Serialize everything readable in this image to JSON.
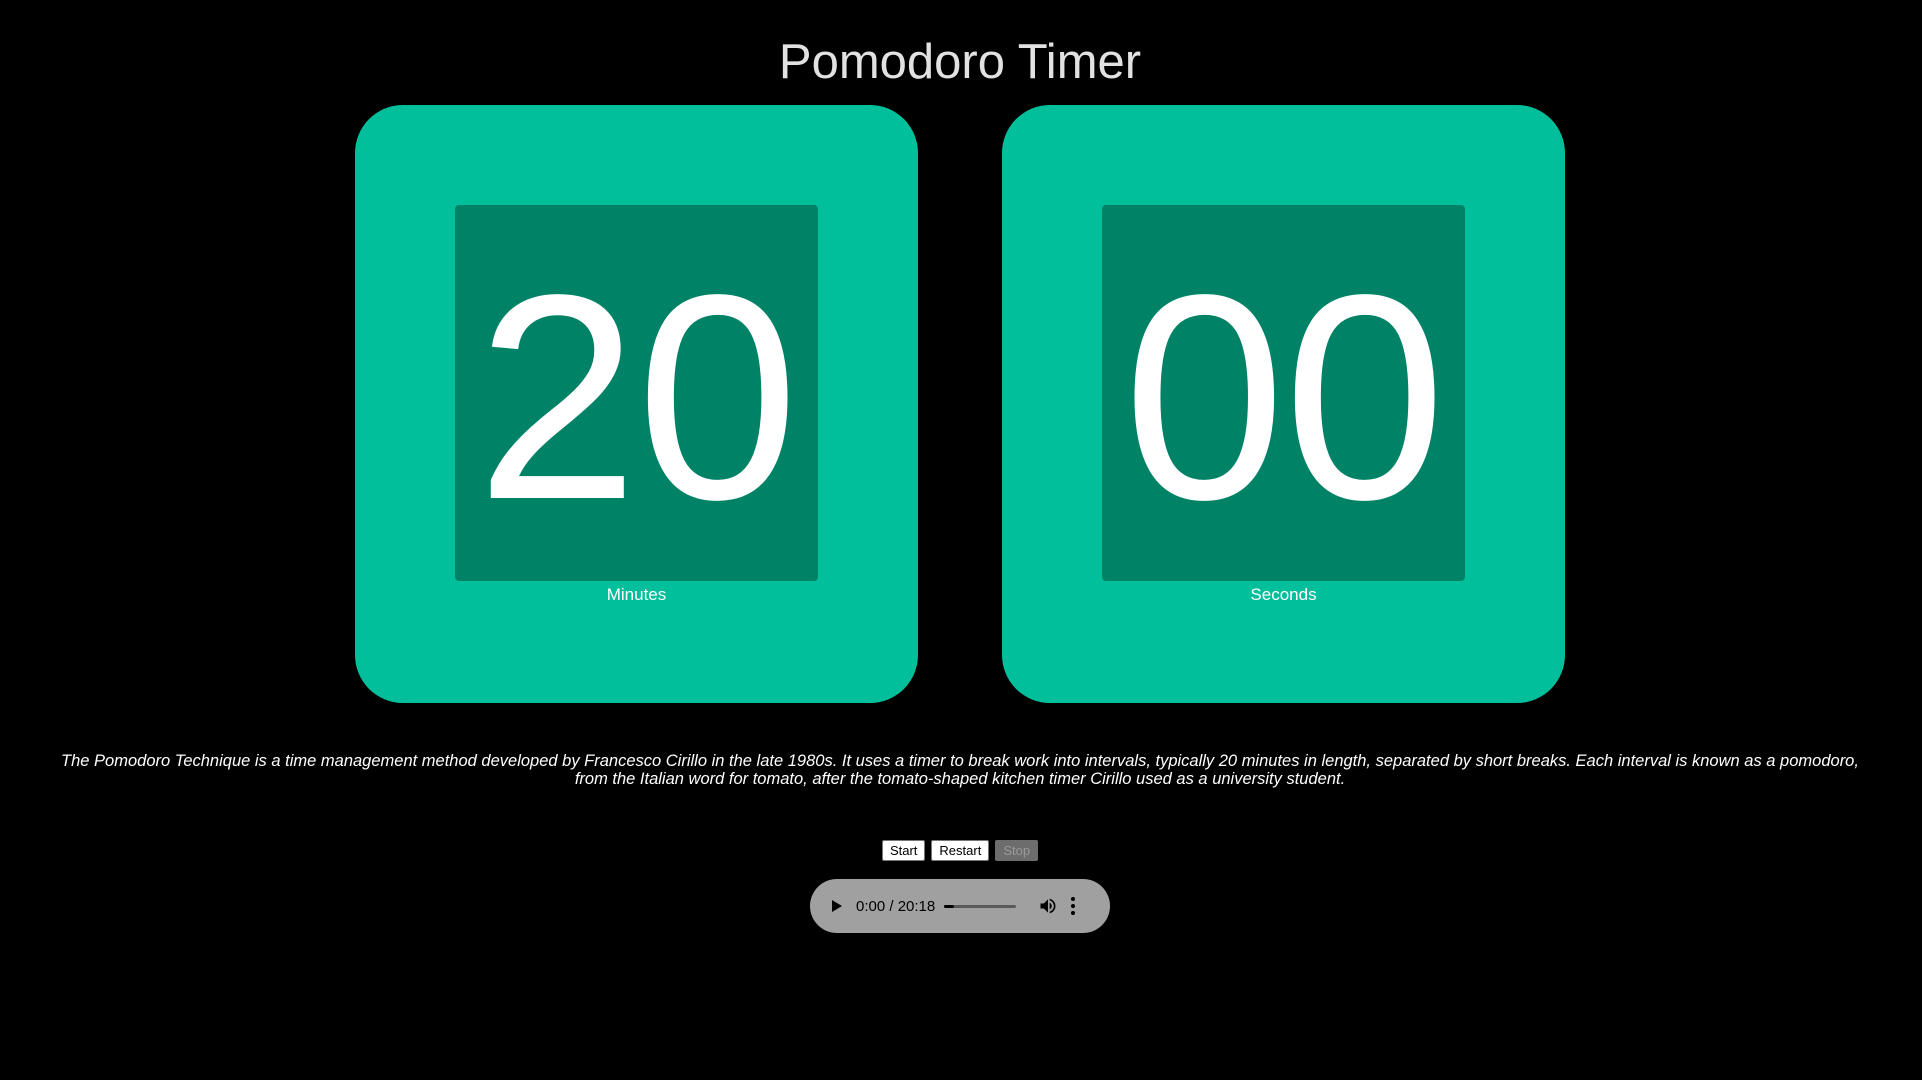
{
  "header": {
    "title": "Pomodoro Timer"
  },
  "timer": {
    "minutes": "20",
    "minutes_label": "Minutes",
    "seconds": "00",
    "seconds_label": "Seconds"
  },
  "description": "The Pomodoro Technique is a time management method developed by Francesco Cirillo in the late 1980s. It uses a timer to break work into intervals, typically 20 minutes in length, separated by short breaks. Each interval is known as a pomodoro, from the Italian word for tomato, after the tomato-shaped kitchen timer Cirillo used as a university student.",
  "controls": {
    "start_label": "Start",
    "restart_label": "Restart",
    "stop_label": "Stop",
    "stop_disabled": true
  },
  "audio": {
    "time": "0:00 / 20:18",
    "progress_fraction": 0.0,
    "buffered_fraction": 0.14,
    "play_icon": "play-icon",
    "volume_icon": "volume-icon",
    "more_icon": "more-options-icon"
  },
  "colors": {
    "background": "#000000",
    "card": "#00bf9a",
    "digit_box": "#008267",
    "title_text": "#e2e2e2",
    "audio_bg": "#a0a0a0"
  }
}
